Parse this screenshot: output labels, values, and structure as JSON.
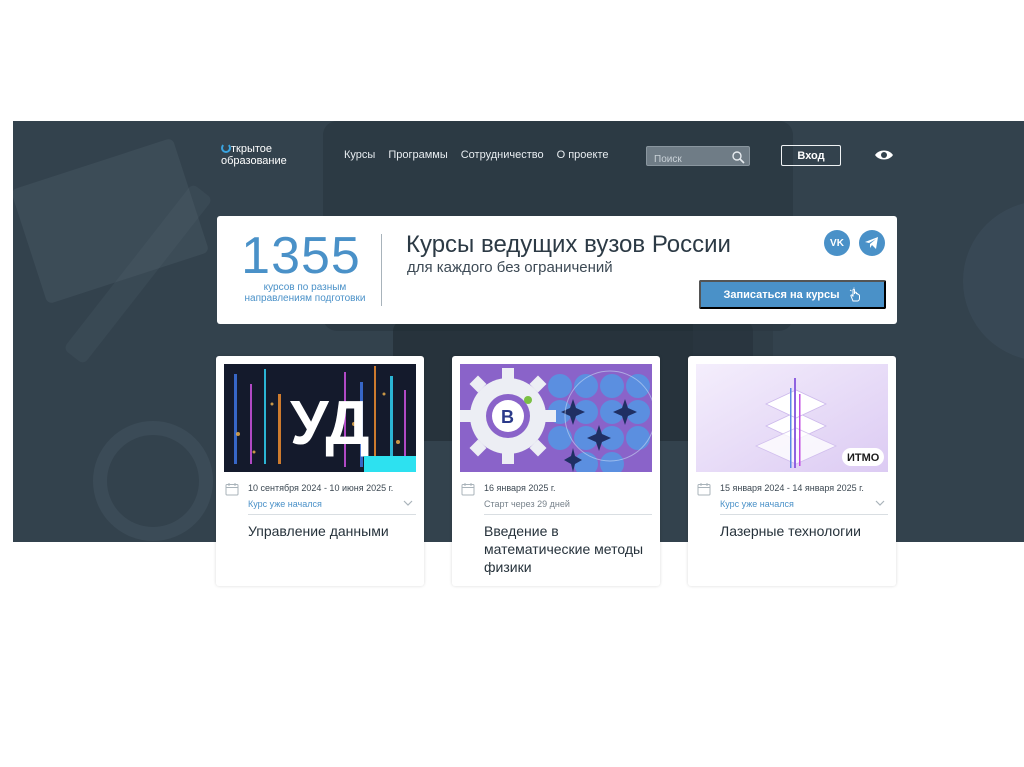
{
  "header": {
    "logo_line1": "ткрытое",
    "logo_line2": "образование",
    "nav": [
      "Курсы",
      "Программы",
      "Сотрудничество",
      "О проекте"
    ],
    "search_placeholder": "Поиск",
    "login_label": "Вход"
  },
  "info": {
    "count": "1355",
    "count_caption_line1": "курсов по разным",
    "count_caption_line2": "направлениям подготовки",
    "headline": "Курсы ведущих вузов России",
    "subheadline": "для каждого без ограничений",
    "enroll_label": "Записаться на курсы"
  },
  "cards": [
    {
      "image_text": "УД",
      "date": "10 сентября 2024 - 10 июня 2025 г.",
      "status": "Курс уже начался",
      "title": "Управление данными"
    },
    {
      "date": "16 января 2025 г.",
      "status": "Старт через 29 дней",
      "title": "Введение в математические методы физики"
    },
    {
      "image_text": "ИТМО",
      "date": "15 января 2024 - 14 января 2025 г.",
      "status": "Курс уже начался",
      "title": "Лазерные технологии"
    }
  ],
  "icons": [
    "search-icon",
    "eye-icon",
    "vk-icon",
    "telegram-icon",
    "pointer-hand-icon",
    "calendar-icon",
    "chevron-down-icon"
  ],
  "colors": {
    "hero_bg": "#33424d",
    "accent": "#4a91c8",
    "card_bg": "#ffffff"
  }
}
